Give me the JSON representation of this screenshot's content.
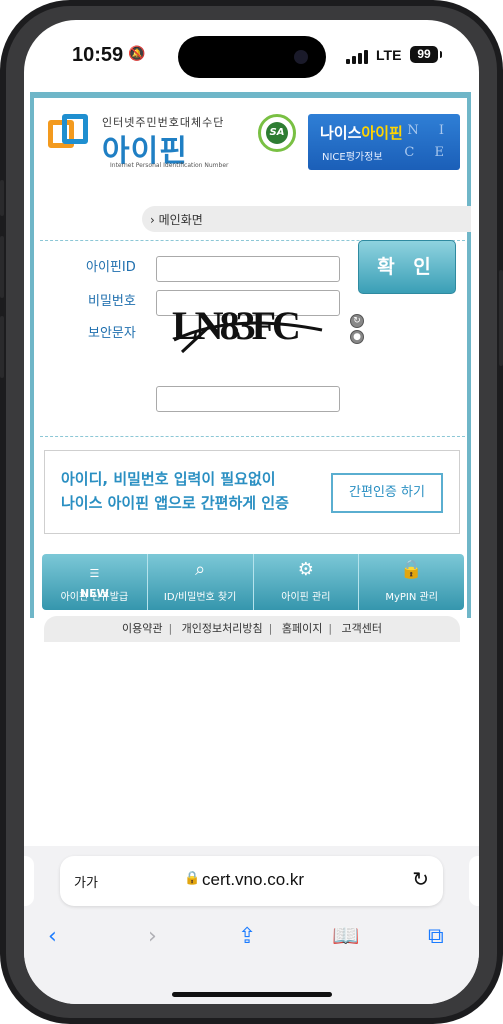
{
  "status_bar": {
    "time": "10:59",
    "network": "LTE",
    "battery": "99"
  },
  "header": {
    "logo_subtitle": "인터넷주민번호대체수단",
    "logo_title": "아이핀",
    "logo_en": "Internet Personal Identification Number",
    "seal_text": "SA",
    "nice_banner_title_prefix": "나이스",
    "nice_banner_title_accent": "아이핀",
    "nice_banner_sub": "NICE평가정보",
    "nice_banner_letters": "N I C E"
  },
  "breadcrumb": {
    "label": "메인화면"
  },
  "login": {
    "id_label": "아이핀ID",
    "pw_label": "비밀번호",
    "captcha_label": "보안문자",
    "confirm_label": "확 인",
    "captcha_text": "LN83FC"
  },
  "promo": {
    "line1": "아이디, 비밀번호 입력이 필요없이",
    "line2": "나이스 아이핀 앱으로 간편하게 인증",
    "button": "간편인증 하기"
  },
  "menu": [
    {
      "icon": "new-icon",
      "label": "아이핀 신규발급",
      "glyph": "NEW"
    },
    {
      "icon": "search-icon",
      "label": "ID/비밀번호 찾기",
      "glyph": "🔍"
    },
    {
      "icon": "gear-icon",
      "label": "아이핀 관리",
      "glyph": "⚙"
    },
    {
      "icon": "lock-icon",
      "label": "MyPIN 관리",
      "glyph": "🔒"
    }
  ],
  "footer": {
    "terms": "이용약관",
    "privacy": "개인정보처리방침",
    "home": "홈페이지",
    "support": "고객센터"
  },
  "browser": {
    "text_size": "가가",
    "url": "cert.vno.co.kr"
  }
}
